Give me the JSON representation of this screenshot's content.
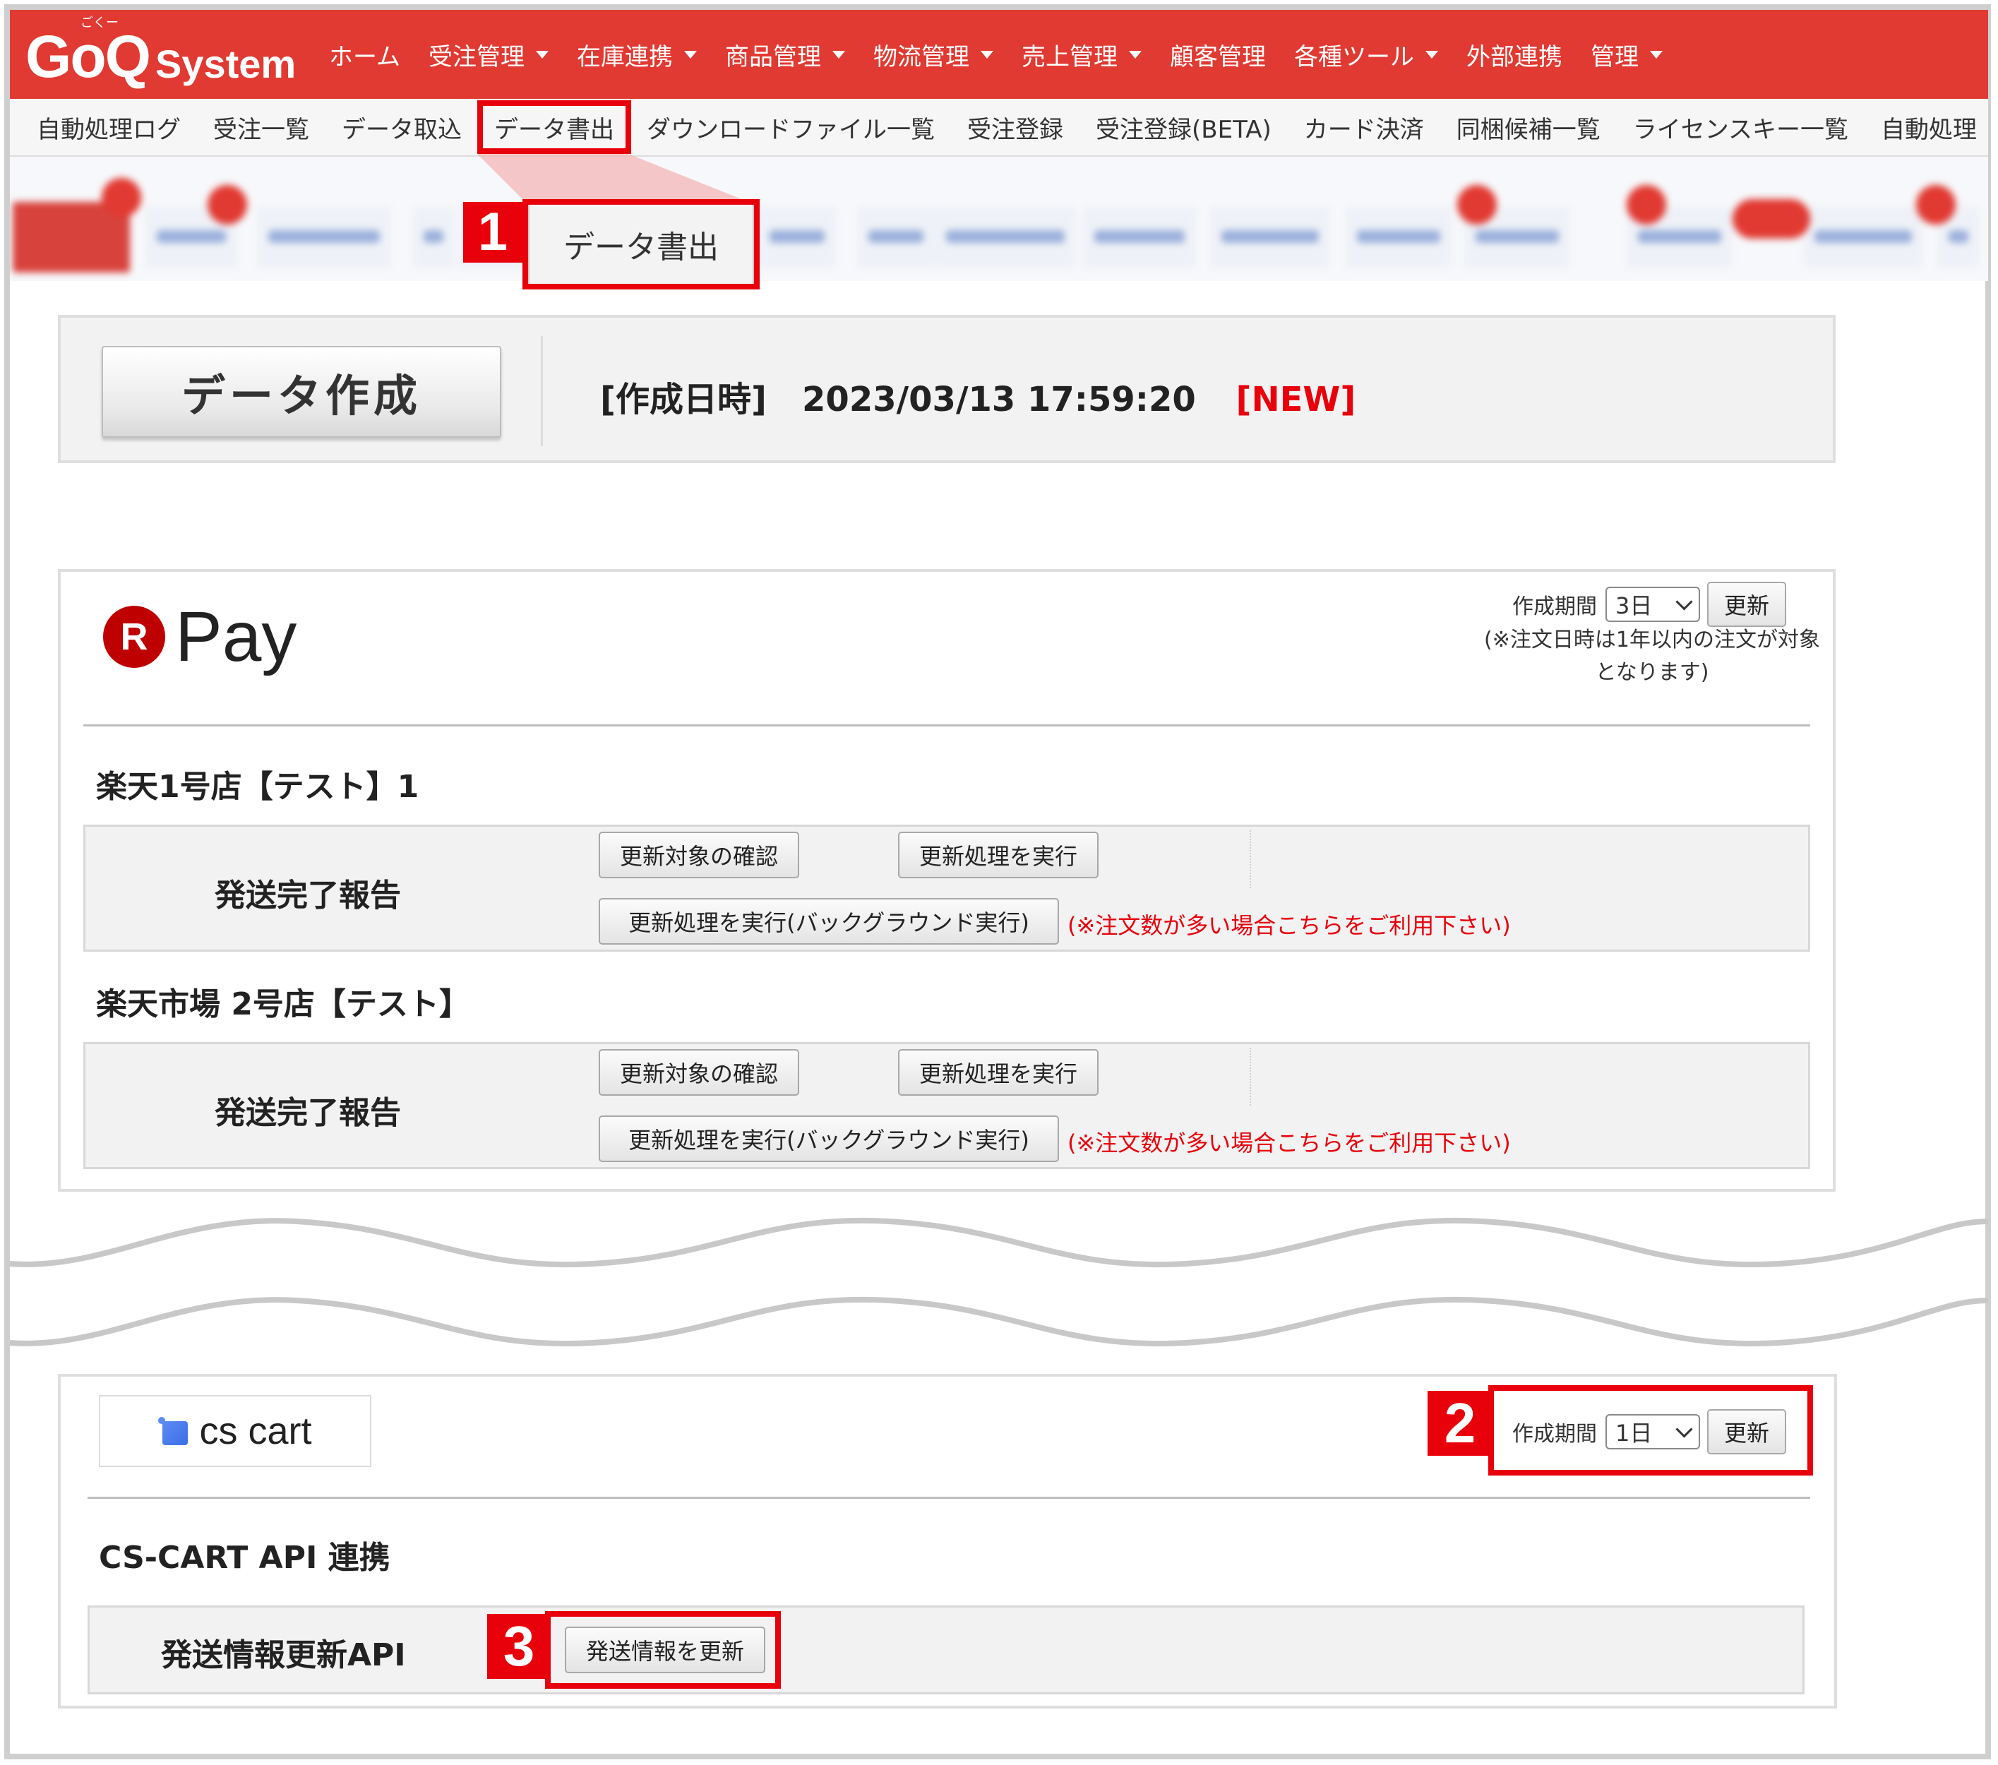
{
  "logo": {
    "ruby": "ごくー",
    "goq": "GoQ",
    "system": "System"
  },
  "nav": {
    "items": [
      {
        "label": "ホーム",
        "dropdown": false
      },
      {
        "label": "受注管理",
        "dropdown": true
      },
      {
        "label": "在庫連携",
        "dropdown": true
      },
      {
        "label": "商品管理",
        "dropdown": true
      },
      {
        "label": "物流管理",
        "dropdown": true
      },
      {
        "label": "売上管理",
        "dropdown": true
      },
      {
        "label": "顧客管理",
        "dropdown": false
      },
      {
        "label": "各種ツール",
        "dropdown": true
      },
      {
        "label": "外部連携",
        "dropdown": false
      },
      {
        "label": "管理",
        "dropdown": true
      }
    ]
  },
  "subnav": {
    "items": [
      "自動処理ログ",
      "受注一覧",
      "データ取込",
      "データ書出",
      "ダウンロードファイル一覧",
      "受注登録",
      "受注登録(BETA)",
      "カード決済",
      "同梱候補一覧",
      "ライセンスキー一覧",
      "自動処理"
    ],
    "active_index": 3
  },
  "callouts": {
    "one": "1",
    "two": "2",
    "three": "3",
    "tab_label": "データ書出"
  },
  "create": {
    "button_label": "データ作成",
    "created_label": "[作成日時]",
    "created_value": "2023/03/13 17:59:20",
    "new_tag": "[NEW]"
  },
  "rpay": {
    "logo_letter": "R",
    "logo_text": "Pay",
    "period_label": "作成期間",
    "period_value": "3日",
    "update_label": "更新",
    "note_line1": "(※注文日時は1年以内の注文が対象",
    "note_line2": "となります)",
    "stores": [
      {
        "name": "楽天1号店【テスト】1",
        "row_label": "発送完了報告",
        "confirm_button": "更新対象の確認",
        "execute_button": "更新処理を実行",
        "background_button": "更新処理を実行(バックグラウンド実行)",
        "note": "(※注文数が多い場合こちらをご利用下さい)"
      },
      {
        "name": "楽天市場 2号店【テスト】",
        "row_label": "発送完了報告",
        "confirm_button": "更新対象の確認",
        "execute_button": "更新処理を実行",
        "background_button": "更新処理を実行(バックグラウンド実行)",
        "note": "(※注文数が多い場合こちらをご利用下さい)"
      }
    ]
  },
  "cscart": {
    "logo_text": "cs cart",
    "period_label": "作成期間",
    "period_value": "1日",
    "update_label": "更新",
    "section_title": "CS-CART API 連携",
    "row_label": "発送情報更新API",
    "row_button": "発送情報を更新"
  },
  "colors": {
    "brand_red": "#e13a32",
    "highlight_red": "#e8000b",
    "rakuten_red": "#bf0000",
    "cscart_blue": "#3b6fe6"
  }
}
